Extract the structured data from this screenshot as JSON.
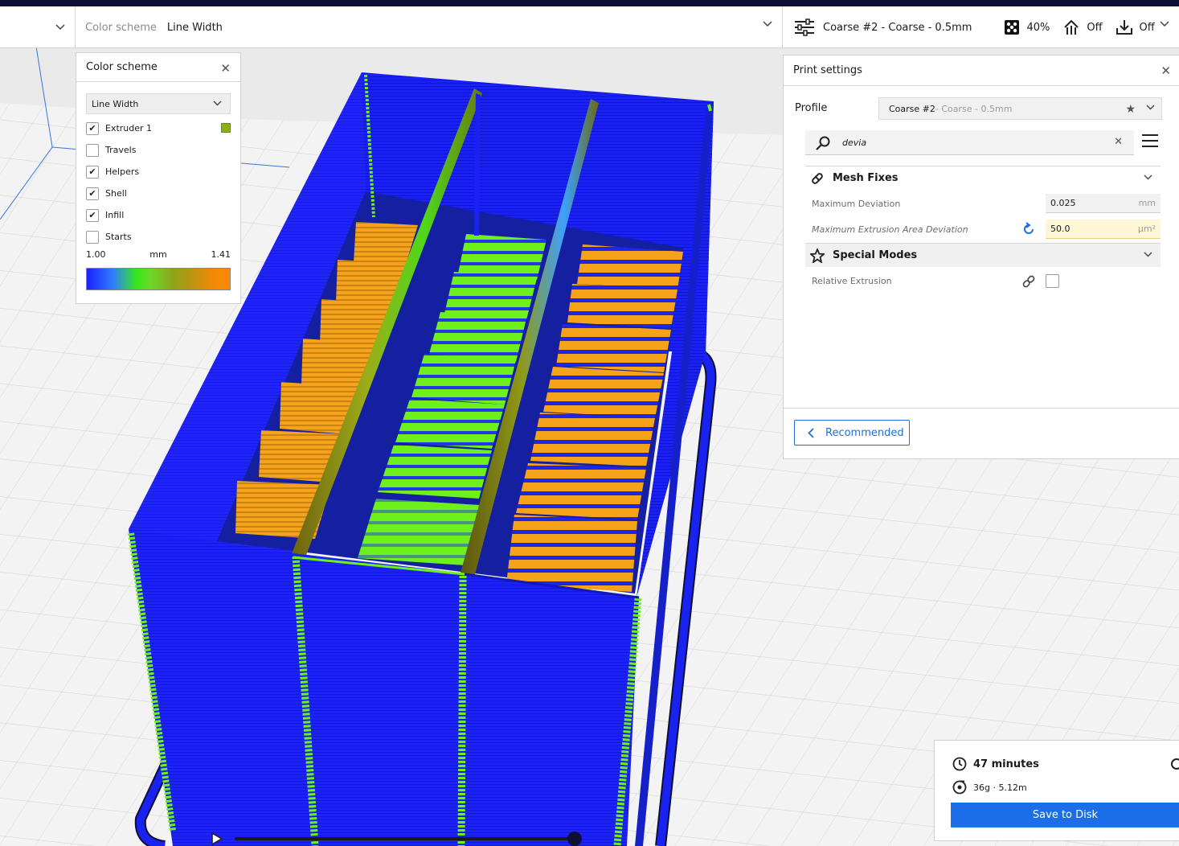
{
  "header": {
    "color_scheme_label": "Color scheme",
    "color_scheme_value": "Line Width",
    "profile": "Coarse #2 - Coarse - 0.5mm",
    "infill": "40%",
    "support": "Off",
    "adhesion": "Off"
  },
  "color_panel": {
    "title": "Color scheme",
    "dropdown": "Line Width",
    "options": [
      {
        "label": "Extruder 1",
        "checked": true
      },
      {
        "label": "Travels",
        "checked": false
      },
      {
        "label": "Helpers",
        "checked": true
      },
      {
        "label": "Shell",
        "checked": true
      },
      {
        "label": "Infill",
        "checked": true
      },
      {
        "label": "Starts",
        "checked": false
      }
    ],
    "extruder_color": "#8aae1c",
    "range_min": "1.00",
    "range_unit": "mm",
    "range_max": "1.41"
  },
  "print_settings": {
    "title": "Print settings",
    "profile_label": "Profile",
    "profile_name": "Coarse #2",
    "profile_sub": " - Coarse - 0.5mm",
    "search_text": "devia",
    "categories": [
      {
        "title": "Mesh Fixes",
        "settings": [
          {
            "label": "Maximum Deviation",
            "value": "0.025",
            "unit": "mm"
          },
          {
            "label": "Maximum Extrusion Area Deviation",
            "value": "50.0",
            "unit": "µm²"
          }
        ]
      },
      {
        "title": "Special Modes",
        "settings": [
          {
            "label": "Relative Extrusion",
            "checked": false
          }
        ]
      }
    ],
    "recommended_button": "Recommended"
  },
  "job": {
    "time": "47 minutes",
    "material": "36g · 5.12m",
    "save_button": "Save to Disk"
  },
  "colors": {
    "accent": "#1b6ee8",
    "topbar": "#0d1034",
    "shell_blue": "#1a22f0",
    "line_green": "#6ef01c",
    "line_orange": "#f7a21b"
  }
}
